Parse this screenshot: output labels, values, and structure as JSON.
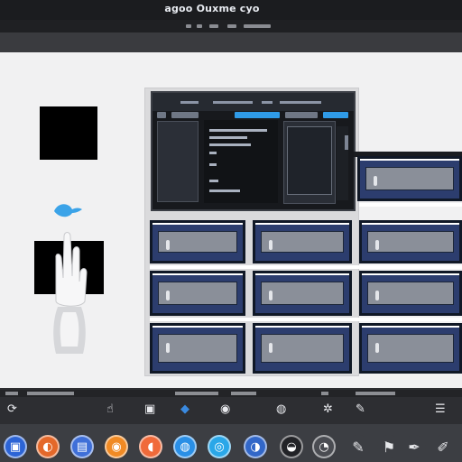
{
  "window": {
    "title": "agoo Ouxme cyo"
  },
  "taskbar_apps": [
    {
      "icon": "blue-app-icon",
      "color": "#2c64d6",
      "glyph": "▣"
    },
    {
      "icon": "orange-blue-app-icon",
      "color": "#e4682a",
      "glyph": "◐"
    },
    {
      "icon": "blue-square-app-icon",
      "color": "#3f6fd8",
      "glyph": "▤"
    },
    {
      "icon": "orange-app-icon",
      "color": "#f08a24",
      "glyph": "◉"
    },
    {
      "icon": "red-orange-app-icon",
      "color": "#f06a3a",
      "glyph": "◖"
    },
    {
      "icon": "blue-circle-app-icon",
      "color": "#2a8fe6",
      "glyph": "◍"
    },
    {
      "icon": "cyan-circle-app-icon",
      "color": "#2aa7e8",
      "glyph": "◎"
    },
    {
      "icon": "blue-yellow-app-icon",
      "color": "#3267c8",
      "glyph": "◑"
    },
    {
      "icon": "dark-circle-app-icon",
      "color": "#222327",
      "glyph": "◒"
    },
    {
      "icon": "grey-circle-app-icon",
      "color": "#4a4c52",
      "glyph": "◔"
    },
    {
      "icon": "wrench-icon",
      "color": "#3c3e43",
      "glyph": "✎"
    },
    {
      "icon": "flag-icon",
      "color": "#3c3e43",
      "glyph": "⚑"
    },
    {
      "icon": "pen-icon",
      "color": "#3c3e43",
      "glyph": "✒"
    },
    {
      "icon": "brush-icon",
      "color": "#3c3e43",
      "glyph": "✐"
    }
  ],
  "colors": {
    "card_fill": "#2c3d6e",
    "card_border": "#101826",
    "panel": "#dadadc",
    "background": "#f1f1f2"
  }
}
